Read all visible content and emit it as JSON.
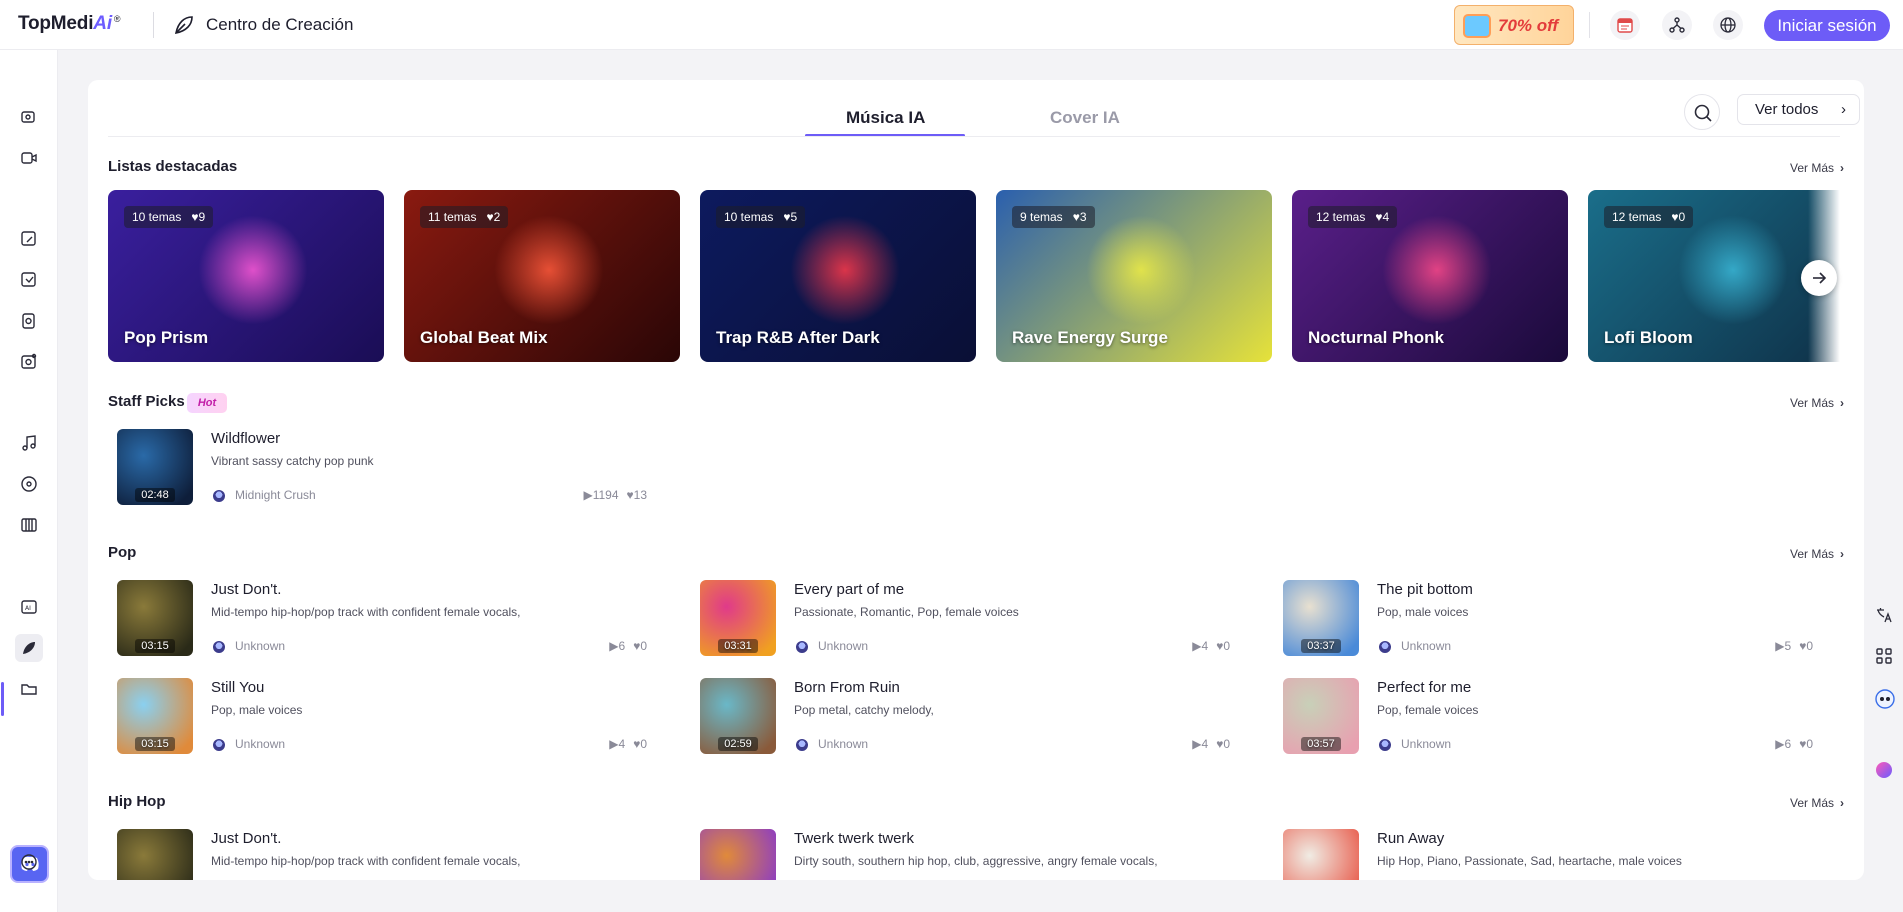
{
  "topbar": {
    "logo_main": "TopMedi",
    "logo_ai": "Ai",
    "logo_reg": "®",
    "section_title": "Centro de Creación",
    "promo_text": "70% off",
    "login_label": "Iniciar sesión"
  },
  "tabs": [
    {
      "label": "Música IA",
      "active": true
    },
    {
      "label": "Cover IA",
      "active": false
    }
  ],
  "ver_todos_label": "Ver todos",
  "sections": {
    "featured": {
      "title": "Listas destacadas",
      "more": "Ver Más"
    },
    "staff": {
      "title": "Staff Picks",
      "badge": "Hot",
      "more": "Ver Más"
    },
    "pop": {
      "title": "Pop",
      "more": "Ver Más"
    },
    "hiphop": {
      "title": "Hip Hop",
      "more": "Ver Más"
    }
  },
  "playlists": [
    {
      "count": "10 temas",
      "likes": "9",
      "title": "Pop Prism",
      "bg": "#3a1f9e",
      "bg2": "#1a0d55",
      "accent": "#ff5ad8"
    },
    {
      "count": "11 temas",
      "likes": "2",
      "title": "Global Beat Mix",
      "bg": "#8a1a10",
      "bg2": "#2a0606",
      "accent": "#ff5a3c"
    },
    {
      "count": "10 temas",
      "likes": "5",
      "title": "Trap R&B After Dark",
      "bg": "#0d1a5e",
      "bg2": "#0a0f35",
      "accent": "#ff3a4a"
    },
    {
      "count": "9 temas",
      "likes": "3",
      "title": "Rave Energy Surge",
      "bg": "#2a5fae",
      "bg2": "#e6e23a",
      "accent": "#f0ee44"
    },
    {
      "count": "12 temas",
      "likes": "4",
      "title": "Nocturnal Phonk",
      "bg": "#5a1f8a",
      "bg2": "#1a0a3a",
      "accent": "#ff4a8a"
    },
    {
      "count": "12 temas",
      "likes": "0",
      "title": "Lofi Bloom",
      "bg": "#1a6e8a",
      "bg2": "#0e2e45",
      "accent": "#3ab8d8"
    }
  ],
  "staff_picks": [
    {
      "title": "Wildflower",
      "desc": "Vibrant sassy catchy pop punk",
      "duration": "02:48",
      "artist": "Midnight Crush",
      "plays": "1194",
      "likes": "13",
      "c1": "#2a6aa8",
      "c2": "#0e1e3a"
    }
  ],
  "pop": [
    {
      "title": "Just Don't.",
      "desc": "Mid-tempo hip-hop/pop track with confident female vocals,",
      "duration": "03:15",
      "artist": "Unknown",
      "plays": "6",
      "likes": "0",
      "c1": "#8a7a3a",
      "c2": "#2a2a18"
    },
    {
      "title": "Every part of me",
      "desc": "Passionate, Romantic, Pop, female voices",
      "duration": "03:31",
      "artist": "Unknown",
      "plays": "4",
      "likes": "0",
      "c1": "#e03a8a",
      "c2": "#f0a020"
    },
    {
      "title": "The pit bottom",
      "desc": "Pop, male voices",
      "duration": "03:37",
      "artist": "Unknown",
      "plays": "5",
      "likes": "0",
      "c1": "#e8e0d0",
      "c2": "#4a8ad8"
    },
    {
      "title": "Still You",
      "desc": "Pop, male voices",
      "duration": "03:15",
      "artist": "Unknown",
      "plays": "4",
      "likes": "0",
      "c1": "#8ad0f0",
      "c2": "#e08a3a"
    },
    {
      "title": "Born From Ruin",
      "desc": "Pop metal, catchy melody,",
      "duration": "02:59",
      "artist": "Unknown",
      "plays": "4",
      "likes": "0",
      "c1": "#6ab8c8",
      "c2": "#8a5a3a"
    },
    {
      "title": "Perfect for me",
      "desc": "Pop, female voices",
      "duration": "03:57",
      "artist": "Unknown",
      "plays": "6",
      "likes": "0",
      "c1": "#c8d0b8",
      "c2": "#e8a0b0"
    }
  ],
  "hiphop": [
    {
      "title": "Just Don't.",
      "desc": "Mid-tempo hip-hop/pop track with confident female vocals,",
      "c1": "#8a7a3a",
      "c2": "#2a2a18"
    },
    {
      "title": "Twerk twerk twerk",
      "desc": "Dirty south, southern hip hop, club, aggressive, angry female vocals,",
      "c1": "#e08a3a",
      "c2": "#8a3ac8"
    },
    {
      "title": "Run Away",
      "desc": "Hip Hop, Piano, Passionate, Sad, heartache, male voices",
      "c1": "#f0ece4",
      "c2": "#e85a4a"
    }
  ]
}
